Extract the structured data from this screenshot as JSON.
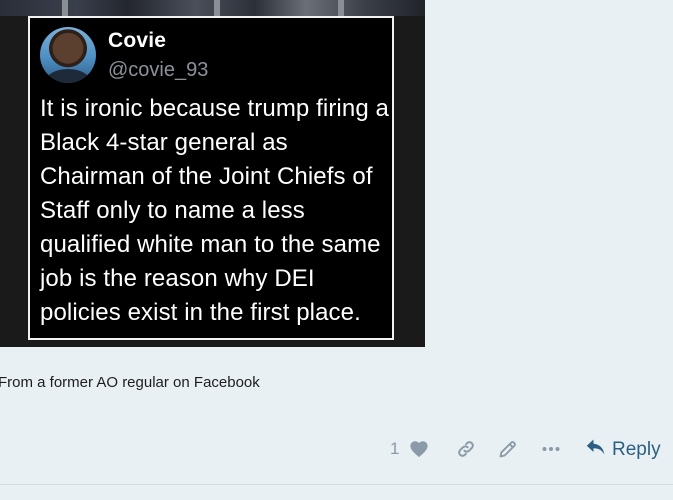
{
  "tweet": {
    "name": "Covie",
    "handle": "@covie_93",
    "text": "It is ironic because trump firing a Black 4-star general as Chairman of the Joint Chiefs of Staff only to name a less qualified white man to the same job is the reason why DEI policies exist in the first place."
  },
  "post": {
    "caption": "From a former AO regular on Facebook"
  },
  "actions": {
    "like_count": "1",
    "reply_label": "Reply",
    "icons": [
      "heart-icon",
      "link-icon",
      "pencil-icon",
      "more-icon",
      "reply-arrow-icon"
    ]
  },
  "colors": {
    "background": "#e9f0f4",
    "action_icon": "#8a9aa8",
    "reply": "#2c5f83"
  }
}
